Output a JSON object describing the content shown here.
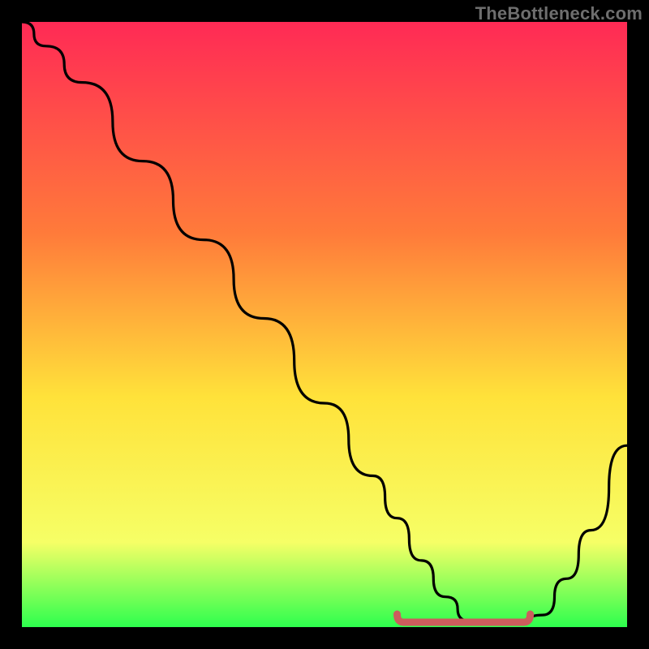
{
  "watermark": {
    "text": "TheBottleneck.com"
  },
  "colors": {
    "background": "#000000",
    "gradient_top": "#ff2a55",
    "gradient_mid1": "#ff7b3a",
    "gradient_mid2": "#ffe23a",
    "gradient_mid3": "#f6ff66",
    "gradient_bottom": "#2dff4e",
    "curve": "#000000",
    "optimum_marker": "#cc5d5d"
  },
  "chart_data": {
    "type": "line",
    "title": "",
    "xlabel": "",
    "ylabel": "",
    "xlim": [
      0,
      100
    ],
    "ylim": [
      0,
      100
    ],
    "series": [
      {
        "name": "bottleneck-curve",
        "x": [
          0,
          4,
          10,
          20,
          30,
          40,
          50,
          58,
          62,
          66,
          70,
          74,
          78,
          82,
          86,
          90,
          94,
          100
        ],
        "y": [
          100,
          96,
          90,
          77,
          64,
          51,
          37,
          25,
          18,
          11,
          5,
          1,
          0.5,
          0.5,
          2,
          8,
          16,
          30
        ]
      }
    ],
    "optimum_range": {
      "x_start": 62,
      "x_end": 84,
      "y": 0.8
    },
    "annotations": [
      {
        "text": "TheBottleneck.com",
        "role": "watermark",
        "pos": "top-right"
      }
    ]
  }
}
